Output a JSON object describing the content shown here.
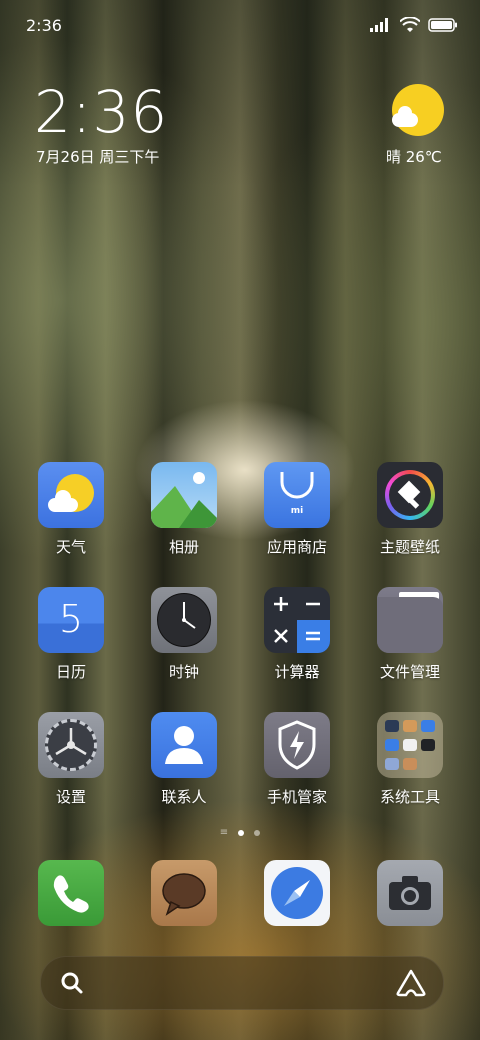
{
  "status_bar": {
    "time": "2:36",
    "signal_icon": "signal-icon",
    "wifi_icon": "wifi-icon",
    "battery_icon": "battery-icon"
  },
  "clock_widget": {
    "time": "2:36",
    "date": "7月26日 周三下午"
  },
  "weather_widget": {
    "icon": "sun-cloud-icon",
    "text": "晴 26℃"
  },
  "apps": [
    {
      "label": "天气",
      "icon": "weather-icon"
    },
    {
      "label": "相册",
      "icon": "gallery-icon"
    },
    {
      "label": "应用商店",
      "icon": "app-store-icon",
      "badge": "mi"
    },
    {
      "label": "主题壁纸",
      "icon": "themes-icon"
    },
    {
      "label": "日历",
      "icon": "calendar-icon",
      "day": "5"
    },
    {
      "label": "时钟",
      "icon": "clock-icon"
    },
    {
      "label": "计算器",
      "icon": "calculator-icon"
    },
    {
      "label": "文件管理",
      "icon": "folder-icon"
    },
    {
      "label": "设置",
      "icon": "settings-icon"
    },
    {
      "label": "联系人",
      "icon": "contacts-icon"
    },
    {
      "label": "手机管家",
      "icon": "security-icon"
    },
    {
      "label": "系统工具",
      "icon": "system-tools-folder-icon"
    }
  ],
  "page_indicator": {
    "pages": 2,
    "current": 1
  },
  "dock": [
    {
      "icon": "phone-icon"
    },
    {
      "icon": "messages-icon"
    },
    {
      "icon": "browser-icon"
    },
    {
      "icon": "camera-icon"
    }
  ],
  "search_bar": {
    "search_icon": "search-icon",
    "assistant_icon": "assistant-icon"
  },
  "colors": {
    "weather_sun": "#f7cf22",
    "icon_blue": "#3a7de0",
    "phone_green": "#3f9e3c"
  }
}
